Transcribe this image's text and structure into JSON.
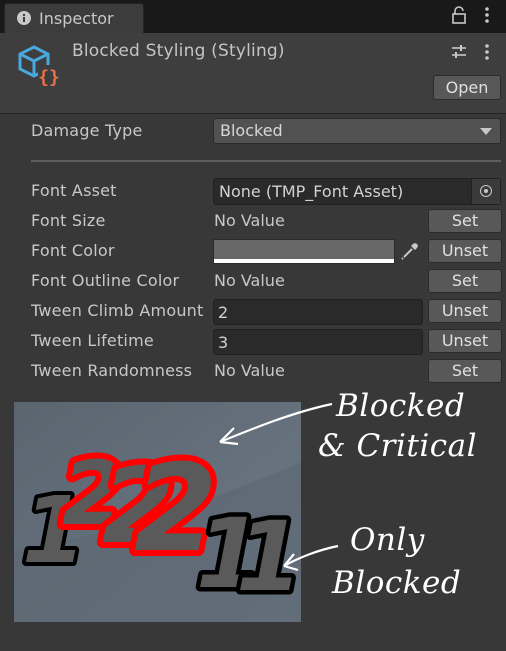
{
  "tab": {
    "title": "Inspector",
    "icon": "info-icon"
  },
  "header": {
    "title": "Blocked Styling (Styling)",
    "icon": "scriptable-object-icon",
    "open_label": "Open"
  },
  "fields": {
    "damage_type": {
      "label": "Damage Type",
      "value": "Blocked"
    },
    "font_asset": {
      "label": "Font Asset",
      "value": "None (TMP_Font Asset)"
    },
    "font_size": {
      "label": "Font Size",
      "value": "No Value",
      "button": "Set"
    },
    "font_color": {
      "label": "Font Color",
      "button": "Unset",
      "swatch": "#686868"
    },
    "font_outline_color": {
      "label": "Font Outline Color",
      "value": "No Value",
      "button": "Set"
    },
    "tween_climb": {
      "label": "Tween Climb Amount",
      "value": "2",
      "button": "Unset"
    },
    "tween_lifetime": {
      "label": "Tween Lifetime",
      "value": "3",
      "button": "Unset"
    },
    "tween_randomness": {
      "label": "Tween Randomness",
      "value": "No Value",
      "button": "Set"
    }
  },
  "preview": {
    "numbers": [
      "1",
      "2",
      "2",
      "2",
      "1",
      "1"
    ]
  },
  "annotations": {
    "top_line1": "Blocked",
    "top_line2": "& Critical",
    "bottom_line1": "Only",
    "bottom_line2": "Blocked"
  },
  "colors": {
    "accent_red": "#ff0000",
    "asset_icon_blue": "#4aa8e0",
    "asset_icon_orange": "#e8734a"
  }
}
